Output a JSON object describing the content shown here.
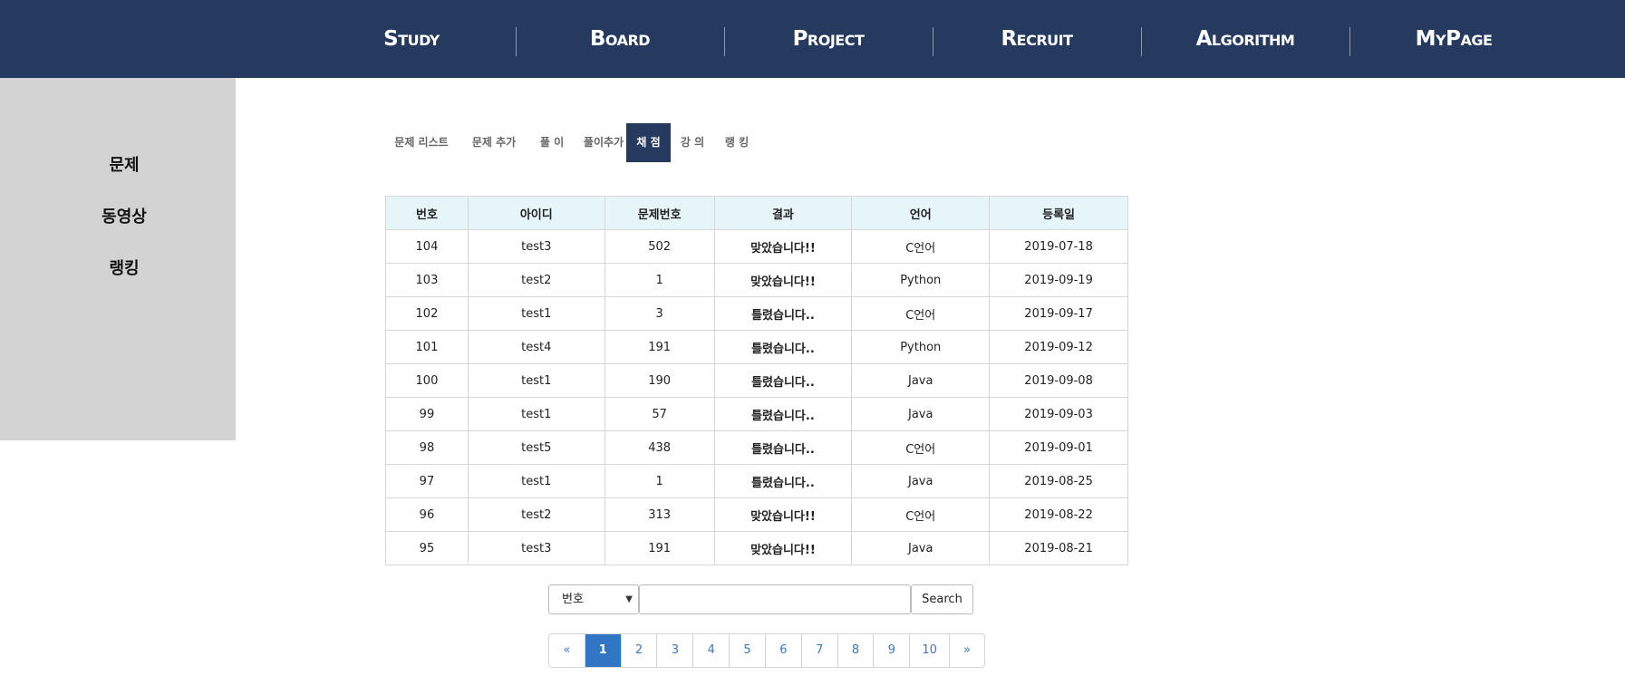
{
  "nav": {
    "items": [
      "Study",
      "Board",
      "Project",
      "Recruit",
      "Algorithm",
      "MyPage"
    ]
  },
  "sidebar": {
    "items": [
      "문제",
      "동영상",
      "랭킹"
    ]
  },
  "tabs": {
    "items": [
      "문제 리스트",
      "문제 추가",
      "풀 이",
      "풀이추가",
      "채 점",
      "강 의",
      "랭 킹"
    ],
    "active": "채 점"
  },
  "table": {
    "headers": [
      "번호",
      "아이디",
      "문제번호",
      "결과",
      "언어",
      "등록일"
    ],
    "rows": [
      {
        "no": "104",
        "id": "test3",
        "problem": "502",
        "result": "맞았습니다!!",
        "status": "correct",
        "lang": "C언어",
        "date": "2019-07-18"
      },
      {
        "no": "103",
        "id": "test2",
        "problem": "1",
        "result": "맞았습니다!!",
        "status": "correct",
        "lang": "Python",
        "date": "2019-09-19"
      },
      {
        "no": "102",
        "id": "test1",
        "problem": "3",
        "result": "틀렸습니다..",
        "status": "wrong",
        "lang": "C언어",
        "date": "2019-09-17"
      },
      {
        "no": "101",
        "id": "test4",
        "problem": "191",
        "result": "틀렸습니다..",
        "status": "wrong",
        "lang": "Python",
        "date": "2019-09-12"
      },
      {
        "no": "100",
        "id": "test1",
        "problem": "190",
        "result": "틀렸습니다..",
        "status": "wrong",
        "lang": "Java",
        "date": "2019-09-08"
      },
      {
        "no": "99",
        "id": "test1",
        "problem": "57",
        "result": "틀렸습니다..",
        "status": "wrong",
        "lang": "Java",
        "date": "2019-09-03"
      },
      {
        "no": "98",
        "id": "test5",
        "problem": "438",
        "result": "틀렸습니다..",
        "status": "wrong",
        "lang": "C언어",
        "date": "2019-09-01"
      },
      {
        "no": "97",
        "id": "test1",
        "problem": "1",
        "result": "틀렸습니다..",
        "status": "wrong",
        "lang": "Java",
        "date": "2019-08-25"
      },
      {
        "no": "96",
        "id": "test2",
        "problem": "313",
        "result": "맞았습니다!!",
        "status": "correct",
        "lang": "C언어",
        "date": "2019-08-22"
      },
      {
        "no": "95",
        "id": "test3",
        "problem": "191",
        "result": "맞았습니다!!",
        "status": "correct",
        "lang": "Java",
        "date": "2019-08-21"
      }
    ]
  },
  "search": {
    "select_value": "번호",
    "input_value": "",
    "button_label": "Search"
  },
  "pagination": {
    "prev": "«",
    "next": "»",
    "pages": [
      "1",
      "2",
      "3",
      "4",
      "5",
      "6",
      "7",
      "8",
      "9",
      "10"
    ],
    "current": "1"
  },
  "colors": {
    "nav_bg": "#253a5e",
    "sidebar_bg": "#d3d3d3",
    "header_bg": "#e6f6f8",
    "correct": "#3f7fe0",
    "wrong": "#f0533c",
    "page_active": "#3176c4"
  }
}
